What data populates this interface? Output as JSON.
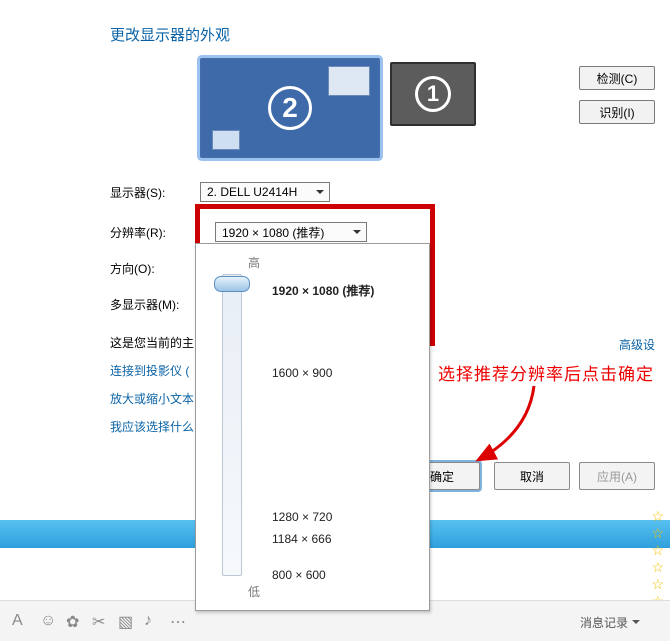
{
  "title": "更改显示器的外观",
  "side_buttons": {
    "detect": "检测(C)",
    "identify": "识别(I)"
  },
  "monitors": {
    "primary_num": "2",
    "secondary_num": "1"
  },
  "labels": {
    "display": "显示器(S):",
    "resolution": "分辨率(R):",
    "orientation": "方向(O):",
    "multi": "多显示器(M):"
  },
  "display_dd": {
    "value": "2. DELL U2414H"
  },
  "resolution_dd": {
    "value": "1920 × 1080 (推荐)",
    "hi": "高",
    "lo": "低",
    "options": [
      "1920 × 1080 (推荐)",
      "1600 × 900",
      "1280 × 720",
      "1184 × 666",
      "800 × 600"
    ],
    "selected_index": 0
  },
  "primary_note": "这是您当前的主",
  "adv_link": "高级设",
  "links": {
    "projector": "连接到投影仪 (",
    "magnifier": "放大或缩小文本",
    "which": "我应该选择什么"
  },
  "buttons": {
    "ok": "确定",
    "cancel": "取消",
    "apply": "应用(A)"
  },
  "annotation": "选择推荐分辨率后点击确定",
  "bottom": {
    "msg_record": "消息记录"
  }
}
